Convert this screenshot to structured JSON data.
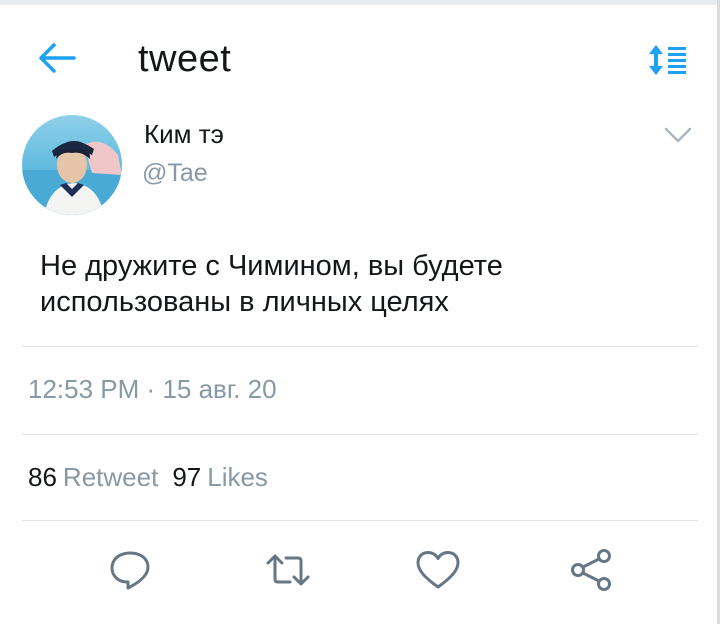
{
  "header": {
    "title": "tweet",
    "back_icon": "arrow-left-icon",
    "sort_icon": "sort-icon",
    "accent_color": "#1da1f2"
  },
  "tweet": {
    "author_name": "Ким тэ",
    "author_handle": "@Tae",
    "text": "Не дружите с Чимином, вы будете использованы в личных целях",
    "time": "12:53 PM",
    "separator": "·",
    "date": "15 авг. 20"
  },
  "stats": {
    "retweets_count": "86",
    "retweets_label": "Retweet",
    "likes_count": "97",
    "likes_label": "Likes"
  },
  "actions": [
    {
      "icon": "reply-icon"
    },
    {
      "icon": "retweet-icon"
    },
    {
      "icon": "heart-icon"
    },
    {
      "icon": "share-icon"
    }
  ],
  "colors": {
    "text": "#14171a",
    "secondary": "#8899a6",
    "icon": "#657786",
    "divider": "#dfe3e7"
  }
}
